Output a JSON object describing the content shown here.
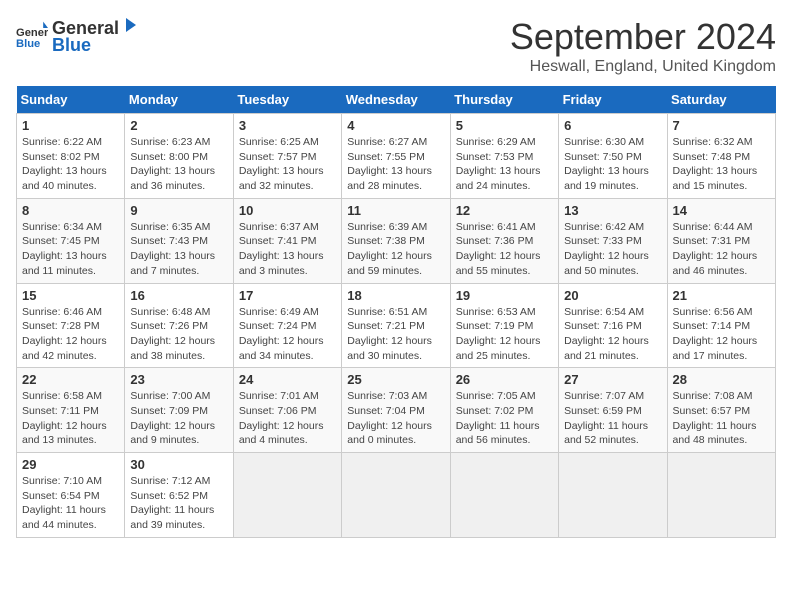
{
  "header": {
    "logo_general": "General",
    "logo_blue": "Blue",
    "title": "September 2024",
    "location": "Heswall, England, United Kingdom"
  },
  "calendar": {
    "days_of_week": [
      "Sunday",
      "Monday",
      "Tuesday",
      "Wednesday",
      "Thursday",
      "Friday",
      "Saturday"
    ],
    "weeks": [
      [
        null,
        {
          "day": "2",
          "sunrise": "6:23 AM",
          "sunset": "8:00 PM",
          "daylight": "13 hours and 36 minutes."
        },
        {
          "day": "3",
          "sunrise": "6:25 AM",
          "sunset": "7:57 PM",
          "daylight": "13 hours and 32 minutes."
        },
        {
          "day": "4",
          "sunrise": "6:27 AM",
          "sunset": "7:55 PM",
          "daylight": "13 hours and 28 minutes."
        },
        {
          "day": "5",
          "sunrise": "6:29 AM",
          "sunset": "7:53 PM",
          "daylight": "13 hours and 24 minutes."
        },
        {
          "day": "6",
          "sunrise": "6:30 AM",
          "sunset": "7:50 PM",
          "daylight": "13 hours and 19 minutes."
        },
        {
          "day": "7",
          "sunrise": "6:32 AM",
          "sunset": "7:48 PM",
          "daylight": "13 hours and 15 minutes."
        }
      ],
      [
        {
          "day": "1",
          "sunrise": "6:22 AM",
          "sunset": "8:02 PM",
          "daylight": "13 hours and 40 minutes."
        },
        {
          "day": "8",
          "sunrise": "6:34 AM",
          "sunset": "7:45 PM",
          "daylight": "13 hours and 11 minutes."
        },
        {
          "day": "9",
          "sunrise": "6:35 AM",
          "sunset": "7:43 PM",
          "daylight": "13 hours and 7 minutes."
        },
        {
          "day": "10",
          "sunrise": "6:37 AM",
          "sunset": "7:41 PM",
          "daylight": "13 hours and 3 minutes."
        },
        {
          "day": "11",
          "sunrise": "6:39 AM",
          "sunset": "7:38 PM",
          "daylight": "12 hours and 59 minutes."
        },
        {
          "day": "12",
          "sunrise": "6:41 AM",
          "sunset": "7:36 PM",
          "daylight": "12 hours and 55 minutes."
        },
        {
          "day": "13",
          "sunrise": "6:42 AM",
          "sunset": "7:33 PM",
          "daylight": "12 hours and 50 minutes."
        },
        {
          "day": "14",
          "sunrise": "6:44 AM",
          "sunset": "7:31 PM",
          "daylight": "12 hours and 46 minutes."
        }
      ],
      [
        {
          "day": "15",
          "sunrise": "6:46 AM",
          "sunset": "7:28 PM",
          "daylight": "12 hours and 42 minutes."
        },
        {
          "day": "16",
          "sunrise": "6:48 AM",
          "sunset": "7:26 PM",
          "daylight": "12 hours and 38 minutes."
        },
        {
          "day": "17",
          "sunrise": "6:49 AM",
          "sunset": "7:24 PM",
          "daylight": "12 hours and 34 minutes."
        },
        {
          "day": "18",
          "sunrise": "6:51 AM",
          "sunset": "7:21 PM",
          "daylight": "12 hours and 30 minutes."
        },
        {
          "day": "19",
          "sunrise": "6:53 AM",
          "sunset": "7:19 PM",
          "daylight": "12 hours and 25 minutes."
        },
        {
          "day": "20",
          "sunrise": "6:54 AM",
          "sunset": "7:16 PM",
          "daylight": "12 hours and 21 minutes."
        },
        {
          "day": "21",
          "sunrise": "6:56 AM",
          "sunset": "7:14 PM",
          "daylight": "12 hours and 17 minutes."
        }
      ],
      [
        {
          "day": "22",
          "sunrise": "6:58 AM",
          "sunset": "7:11 PM",
          "daylight": "12 hours and 13 minutes."
        },
        {
          "day": "23",
          "sunrise": "7:00 AM",
          "sunset": "7:09 PM",
          "daylight": "12 hours and 9 minutes."
        },
        {
          "day": "24",
          "sunrise": "7:01 AM",
          "sunset": "7:06 PM",
          "daylight": "12 hours and 4 minutes."
        },
        {
          "day": "25",
          "sunrise": "7:03 AM",
          "sunset": "7:04 PM",
          "daylight": "12 hours and 0 minutes."
        },
        {
          "day": "26",
          "sunrise": "7:05 AM",
          "sunset": "7:02 PM",
          "daylight": "11 hours and 56 minutes."
        },
        {
          "day": "27",
          "sunrise": "7:07 AM",
          "sunset": "6:59 PM",
          "daylight": "11 hours and 52 minutes."
        },
        {
          "day": "28",
          "sunrise": "7:08 AM",
          "sunset": "6:57 PM",
          "daylight": "11 hours and 48 minutes."
        }
      ],
      [
        {
          "day": "29",
          "sunrise": "7:10 AM",
          "sunset": "6:54 PM",
          "daylight": "11 hours and 44 minutes."
        },
        {
          "day": "30",
          "sunrise": "7:12 AM",
          "sunset": "6:52 PM",
          "daylight": "11 hours and 39 minutes."
        },
        null,
        null,
        null,
        null,
        null
      ]
    ]
  }
}
